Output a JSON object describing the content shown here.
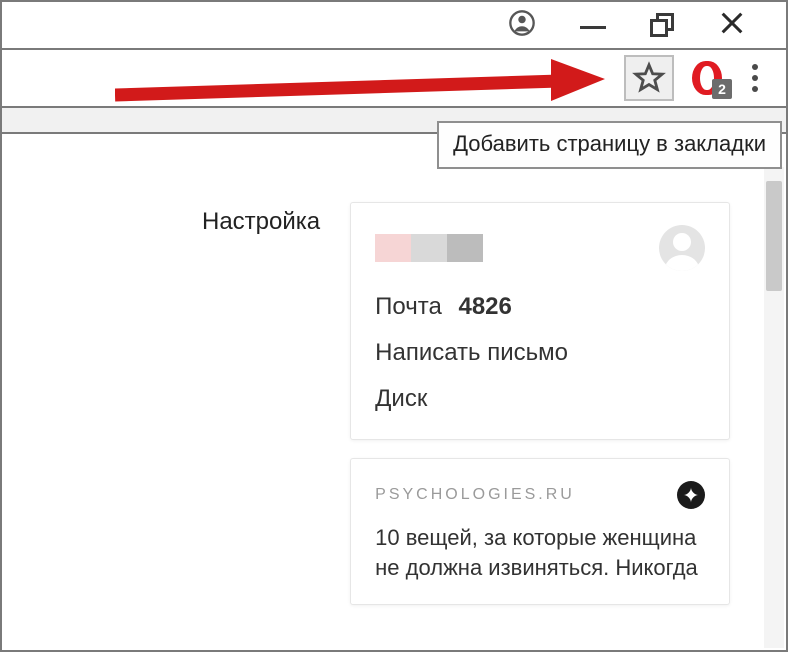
{
  "tooltip": "Добавить страницу в закладки",
  "opera_badge": "2",
  "settings_label": "Настройка",
  "user_card": {
    "mail_label": "Почта",
    "mail_count": "4826",
    "compose_label": "Написать письмо",
    "disk_label": "Диск"
  },
  "news_card": {
    "source": "PSYCHOLOGIES.RU",
    "title": "10 вещей, за которые женщина не должна извиняться. Никогда"
  }
}
